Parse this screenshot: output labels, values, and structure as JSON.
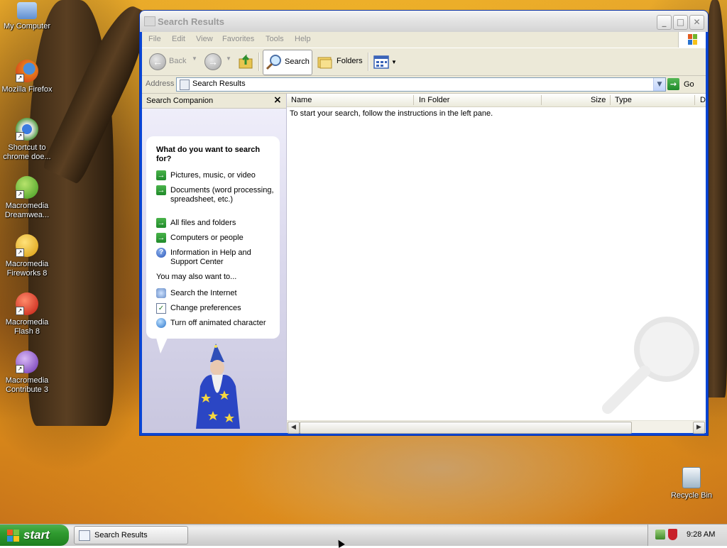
{
  "desktop": {
    "icons": [
      {
        "label": "My Computer",
        "icon": "my-computer-icon"
      },
      {
        "label": "Mozilla Firefox",
        "icon": "firefox-icon"
      },
      {
        "label": "Shortcut to chrome doe...",
        "icon": "chrome-icon"
      },
      {
        "label": "Macromedia Dreamwea...",
        "icon": "dreamweaver-icon"
      },
      {
        "label": "Macromedia Fireworks 8",
        "icon": "fireworks-icon"
      },
      {
        "label": "Macromedia Flash 8",
        "icon": "flash-icon"
      },
      {
        "label": "Macromedia Contribute 3",
        "icon": "contribute-icon"
      },
      {
        "label": "Recycle Bin",
        "icon": "recycle-bin-icon"
      }
    ]
  },
  "window": {
    "title": "Search Results",
    "controls": {
      "minimize": "_",
      "maximize": "□",
      "close": "✕"
    },
    "menu": [
      "File",
      "Edit",
      "View",
      "Favorites",
      "Tools",
      "Help"
    ],
    "toolbar": {
      "back": "Back",
      "search": "Search",
      "folders": "Folders"
    },
    "address": {
      "label": "Address",
      "value": "Search Results",
      "go": "Go"
    },
    "companion": {
      "title": "Search Companion",
      "close": "×",
      "question": "What do you want to search for?",
      "options": [
        "Pictures, music, or video",
        "Documents (word processing, spreadsheet, etc.)",
        "All files and folders",
        "Computers or people",
        "Information in Help and Support Center"
      ],
      "also": "You may also want to...",
      "extras": [
        "Search the Internet",
        "Change preferences",
        "Turn off animated character"
      ]
    },
    "results": {
      "columns": [
        "Name",
        "In Folder",
        "Size",
        "Type",
        "D"
      ],
      "hint": "To start your search, follow the instructions in the left pane."
    }
  },
  "taskbar": {
    "start": "start",
    "task": "Search Results",
    "clock": "9:28 AM"
  },
  "colors": {
    "start_green": "#2f9b2f",
    "window_blue": "#0a46d4",
    "arrow_green": "#1f8a2a"
  }
}
